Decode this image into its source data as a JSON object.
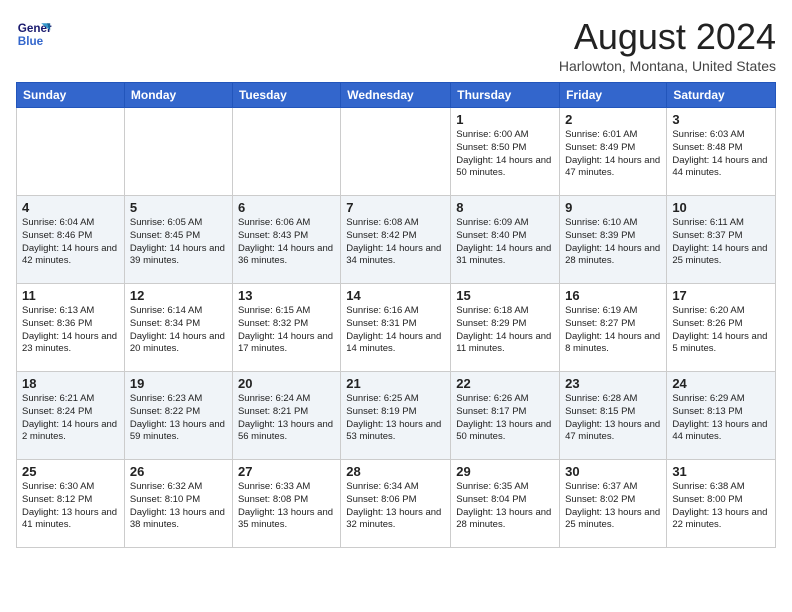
{
  "logo": {
    "text_general": "General",
    "text_blue": "Blue"
  },
  "title": "August 2024",
  "location": "Harlowton, Montana, United States",
  "days_of_week": [
    "Sunday",
    "Monday",
    "Tuesday",
    "Wednesday",
    "Thursday",
    "Friday",
    "Saturday"
  ],
  "weeks": [
    [
      {
        "day": "",
        "text": ""
      },
      {
        "day": "",
        "text": ""
      },
      {
        "day": "",
        "text": ""
      },
      {
        "day": "",
        "text": ""
      },
      {
        "day": "1",
        "text": "Sunrise: 6:00 AM\nSunset: 8:50 PM\nDaylight: 14 hours and 50 minutes."
      },
      {
        "day": "2",
        "text": "Sunrise: 6:01 AM\nSunset: 8:49 PM\nDaylight: 14 hours and 47 minutes."
      },
      {
        "day": "3",
        "text": "Sunrise: 6:03 AM\nSunset: 8:48 PM\nDaylight: 14 hours and 44 minutes."
      }
    ],
    [
      {
        "day": "4",
        "text": "Sunrise: 6:04 AM\nSunset: 8:46 PM\nDaylight: 14 hours and 42 minutes."
      },
      {
        "day": "5",
        "text": "Sunrise: 6:05 AM\nSunset: 8:45 PM\nDaylight: 14 hours and 39 minutes."
      },
      {
        "day": "6",
        "text": "Sunrise: 6:06 AM\nSunset: 8:43 PM\nDaylight: 14 hours and 36 minutes."
      },
      {
        "day": "7",
        "text": "Sunrise: 6:08 AM\nSunset: 8:42 PM\nDaylight: 14 hours and 34 minutes."
      },
      {
        "day": "8",
        "text": "Sunrise: 6:09 AM\nSunset: 8:40 PM\nDaylight: 14 hours and 31 minutes."
      },
      {
        "day": "9",
        "text": "Sunrise: 6:10 AM\nSunset: 8:39 PM\nDaylight: 14 hours and 28 minutes."
      },
      {
        "day": "10",
        "text": "Sunrise: 6:11 AM\nSunset: 8:37 PM\nDaylight: 14 hours and 25 minutes."
      }
    ],
    [
      {
        "day": "11",
        "text": "Sunrise: 6:13 AM\nSunset: 8:36 PM\nDaylight: 14 hours and 23 minutes."
      },
      {
        "day": "12",
        "text": "Sunrise: 6:14 AM\nSunset: 8:34 PM\nDaylight: 14 hours and 20 minutes."
      },
      {
        "day": "13",
        "text": "Sunrise: 6:15 AM\nSunset: 8:32 PM\nDaylight: 14 hours and 17 minutes."
      },
      {
        "day": "14",
        "text": "Sunrise: 6:16 AM\nSunset: 8:31 PM\nDaylight: 14 hours and 14 minutes."
      },
      {
        "day": "15",
        "text": "Sunrise: 6:18 AM\nSunset: 8:29 PM\nDaylight: 14 hours and 11 minutes."
      },
      {
        "day": "16",
        "text": "Sunrise: 6:19 AM\nSunset: 8:27 PM\nDaylight: 14 hours and 8 minutes."
      },
      {
        "day": "17",
        "text": "Sunrise: 6:20 AM\nSunset: 8:26 PM\nDaylight: 14 hours and 5 minutes."
      }
    ],
    [
      {
        "day": "18",
        "text": "Sunrise: 6:21 AM\nSunset: 8:24 PM\nDaylight: 14 hours and 2 minutes."
      },
      {
        "day": "19",
        "text": "Sunrise: 6:23 AM\nSunset: 8:22 PM\nDaylight: 13 hours and 59 minutes."
      },
      {
        "day": "20",
        "text": "Sunrise: 6:24 AM\nSunset: 8:21 PM\nDaylight: 13 hours and 56 minutes."
      },
      {
        "day": "21",
        "text": "Sunrise: 6:25 AM\nSunset: 8:19 PM\nDaylight: 13 hours and 53 minutes."
      },
      {
        "day": "22",
        "text": "Sunrise: 6:26 AM\nSunset: 8:17 PM\nDaylight: 13 hours and 50 minutes."
      },
      {
        "day": "23",
        "text": "Sunrise: 6:28 AM\nSunset: 8:15 PM\nDaylight: 13 hours and 47 minutes."
      },
      {
        "day": "24",
        "text": "Sunrise: 6:29 AM\nSunset: 8:13 PM\nDaylight: 13 hours and 44 minutes."
      }
    ],
    [
      {
        "day": "25",
        "text": "Sunrise: 6:30 AM\nSunset: 8:12 PM\nDaylight: 13 hours and 41 minutes."
      },
      {
        "day": "26",
        "text": "Sunrise: 6:32 AM\nSunset: 8:10 PM\nDaylight: 13 hours and 38 minutes."
      },
      {
        "day": "27",
        "text": "Sunrise: 6:33 AM\nSunset: 8:08 PM\nDaylight: 13 hours and 35 minutes."
      },
      {
        "day": "28",
        "text": "Sunrise: 6:34 AM\nSunset: 8:06 PM\nDaylight: 13 hours and 32 minutes."
      },
      {
        "day": "29",
        "text": "Sunrise: 6:35 AM\nSunset: 8:04 PM\nDaylight: 13 hours and 28 minutes."
      },
      {
        "day": "30",
        "text": "Sunrise: 6:37 AM\nSunset: 8:02 PM\nDaylight: 13 hours and 25 minutes."
      },
      {
        "day": "31",
        "text": "Sunrise: 6:38 AM\nSunset: 8:00 PM\nDaylight: 13 hours and 22 minutes."
      }
    ]
  ]
}
